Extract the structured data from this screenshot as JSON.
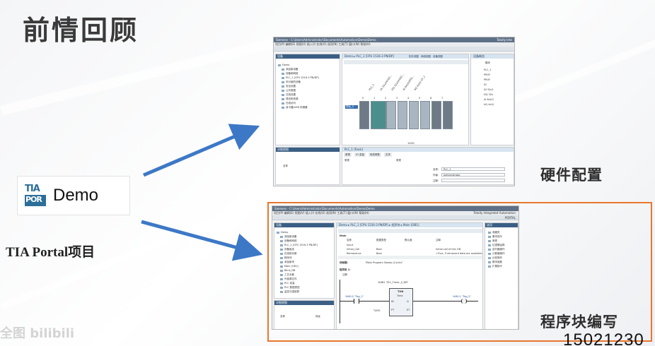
{
  "slide": {
    "title": "前情回顾",
    "project_tile": {
      "logo_top": "TIA",
      "logo_bottom": "POR",
      "name": "Demo"
    },
    "project_label": "TIA Portal项目",
    "captions": {
      "hardware": "硬件配置",
      "program": "程序块编写"
    },
    "watermark": "全图 bilibili",
    "number_partial": "15021230"
  },
  "shot_hardware": {
    "window_title": "Siemens - C:\\Users\\Administrator\\Documents\\Automation\\Demo\\Demo",
    "brand": "Totally Inte",
    "menu": "项目(P)  编辑(E)  视图(V)  插入(I)  在线(O)  选项(N)  工具(T)  窗口(W)  帮助(H)",
    "breadcrumb": "Demo ▸ PLC_1 [CPU 1516-3 PN/DP]",
    "tree_head": "设备",
    "tree": [
      "Demo",
      "添加新设备",
      "设备和网络",
      "PLC_1 [CPU 1516-3 PN/DP]",
      "未分组的设备",
      "安全设置",
      "公共数据",
      "文档设置",
      "语言和资源",
      "在线访问",
      "读卡器/USB 存储器"
    ],
    "view_tabs": [
      "拓扑视图",
      "网络视图",
      "设备视图"
    ],
    "overview_head": "设备概览",
    "overview_col": "模块",
    "overview_rows": [
      "PLC_1",
      "PROF",
      "PROF",
      "DI",
      "DI 32x2",
      "DQ 32x",
      "AI 8xU/I",
      "AQ 4xU/"
    ],
    "rack_labels": [
      "PLC_1",
      "DI 32x24VDC...",
      "DQ 32x24VDC...",
      "AI 8xU/I/RTD...",
      "AQ 4xU/I ST_1"
    ],
    "slot_numbers": [
      "0",
      "1",
      "2",
      "3",
      "4",
      "5",
      "6",
      "7"
    ],
    "rack_tag": "导轨_0",
    "details_head": "详细视图",
    "details_col": "名称",
    "props_crumb": "PLC_1 [Rack]",
    "props_tabs": [
      "常规",
      "IO 变量",
      "系统常数",
      "文本"
    ],
    "props_nav": "常规",
    "props_section": "常规",
    "props_name_label": "名称:",
    "props_name_value": "PLC_1",
    "props_author_label": "作者:",
    "props_author_value": "Administrator",
    "props_comment_label": "注释:",
    "zoom": "100%"
  },
  "shot_program": {
    "window_title": "Siemens - C:\\Users\\Administrator\\Documents\\Automation\\Demo\\Demo",
    "brand_line1": "Totally Integrated Automation",
    "brand_line2": "PORTAL",
    "menu": "项目(P)  编辑(E)  视图(V)  插入(I)  在线(O)  选项(N)  工具(T)  窗口(W)  帮助(H)",
    "breadcrumb": "Demo ▸ PLC_1 [CPU 1516-3 PN/DP] ▸ 程序块 ▸ Main [OB1]",
    "tree_head": "设备",
    "tree": [
      "Demo",
      "添加新设备",
      "设备和网络",
      "PLC_1 [CPU 1516-3 PN/DP]",
      "设备组态",
      "在线和诊断",
      "程序块",
      "添加新块",
      "Main [OB1]",
      "Blink_DB",
      "工艺对象",
      "外部源文件",
      "PLC 变量",
      "PLC 数据类型",
      "监控与强制表"
    ],
    "iface_head": "Main",
    "iface_cols": [
      "名称",
      "数据类型",
      "默认值",
      "注释"
    ],
    "iface_rows": [
      {
        "name": "Input",
        "type": "",
        "value": ""
      },
      {
        "name": "Initial_Call",
        "type": "Bool",
        "value": "Initial call of this OB"
      },
      {
        "name": "Remanence",
        "type": "Bool",
        "value": "=True, if remanent data are available"
      }
    ],
    "block_title_label": "块标题:",
    "block_title_value": "\"Main Program Sweep (Cycle)\"",
    "network_label": "程序段 1:",
    "net_comment": "注释",
    "ladder": {
      "db_name": "%DB1 \"IEC_Timer_0_DB\"",
      "timer_type": "TON",
      "timer_unit": "Time",
      "input_tag": "%M0.0 \"Tag_1\"",
      "output_tag": "%M0.1 \"Tag_2\"",
      "pins": [
        "IN",
        "Q",
        "PT",
        "ET"
      ],
      "pt_value": "T#5S"
    },
    "details_head": "详细视图",
    "details_col": "名称",
    "details_col2": "地址",
    "right_head": "选项",
    "right_sections": [
      "收藏夹",
      "基本指令",
      "常规",
      "位逻辑运算",
      "定时器操作",
      "计数器操作",
      "比较操作",
      "数学函数",
      "扩展指令"
    ]
  },
  "colors": {
    "accent_orange": "#e8772e",
    "arrow_blue": "#3d78c6",
    "tia_blue": "#2c6e99",
    "title_text": "#3a3a3a"
  }
}
